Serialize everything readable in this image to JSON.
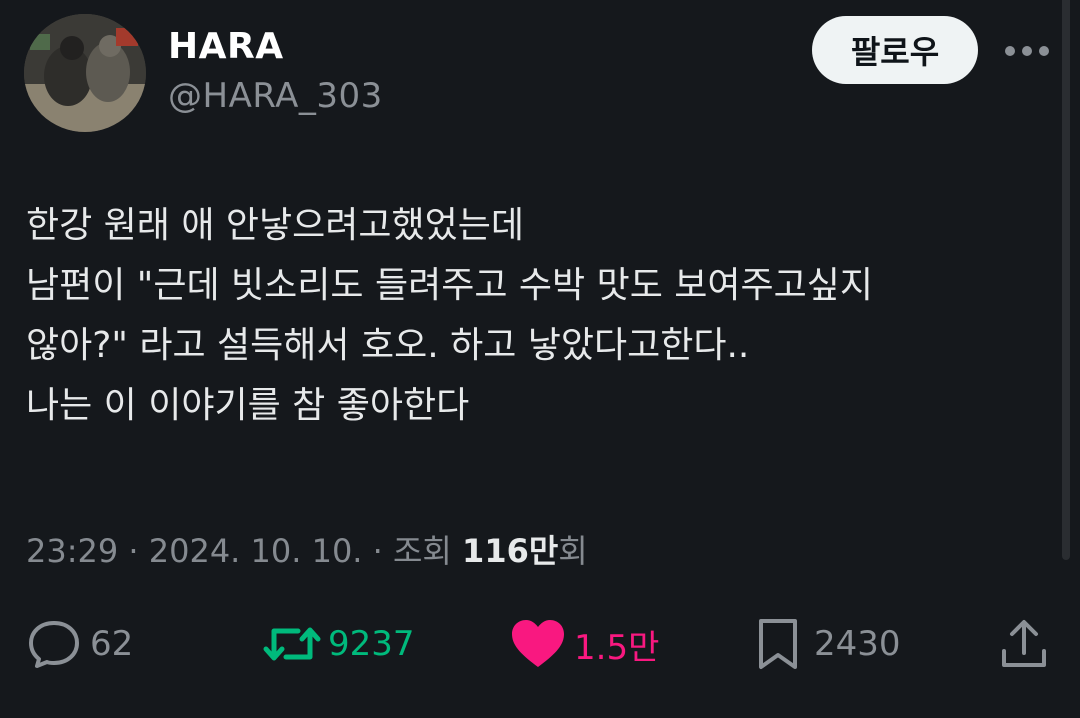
{
  "author": {
    "name": "HARA",
    "handle": "@HARA_303"
  },
  "follow_label": "팔로우",
  "more_icon": "more-horizontal-icon",
  "tweet": {
    "lines": [
      "한강 원래 애 안낳으려고했었는데",
      "남편이 \"근데 빗소리도 들려주고 수박 맛도 보여주고싶지",
      "않아?\" 라고 설득해서 호오. 하고 낳았다고한다..",
      "나는 이 이야기를 참 좋아한다"
    ]
  },
  "meta": {
    "timestamp": "23:29 · 2024. 10. 10. · ",
    "views_prefix": "조회 ",
    "views_count": "116만",
    "views_suffix": "회"
  },
  "actions": {
    "reply": {
      "icon": "reply-bubble-icon",
      "count": "62"
    },
    "retweet": {
      "icon": "retweet-icon",
      "count": "9237"
    },
    "like": {
      "icon": "heart-icon",
      "count": "1.5만"
    },
    "bookmark": {
      "icon": "bookmark-icon",
      "count": "2430"
    },
    "share": {
      "icon": "share-icon"
    }
  },
  "colors": {
    "background": "#15181c",
    "text": "#e7e9ea",
    "secondary": "#8b9096",
    "retweet": "#00ba7c",
    "like": "#f91880",
    "follow_bg": "#eff3f4"
  }
}
